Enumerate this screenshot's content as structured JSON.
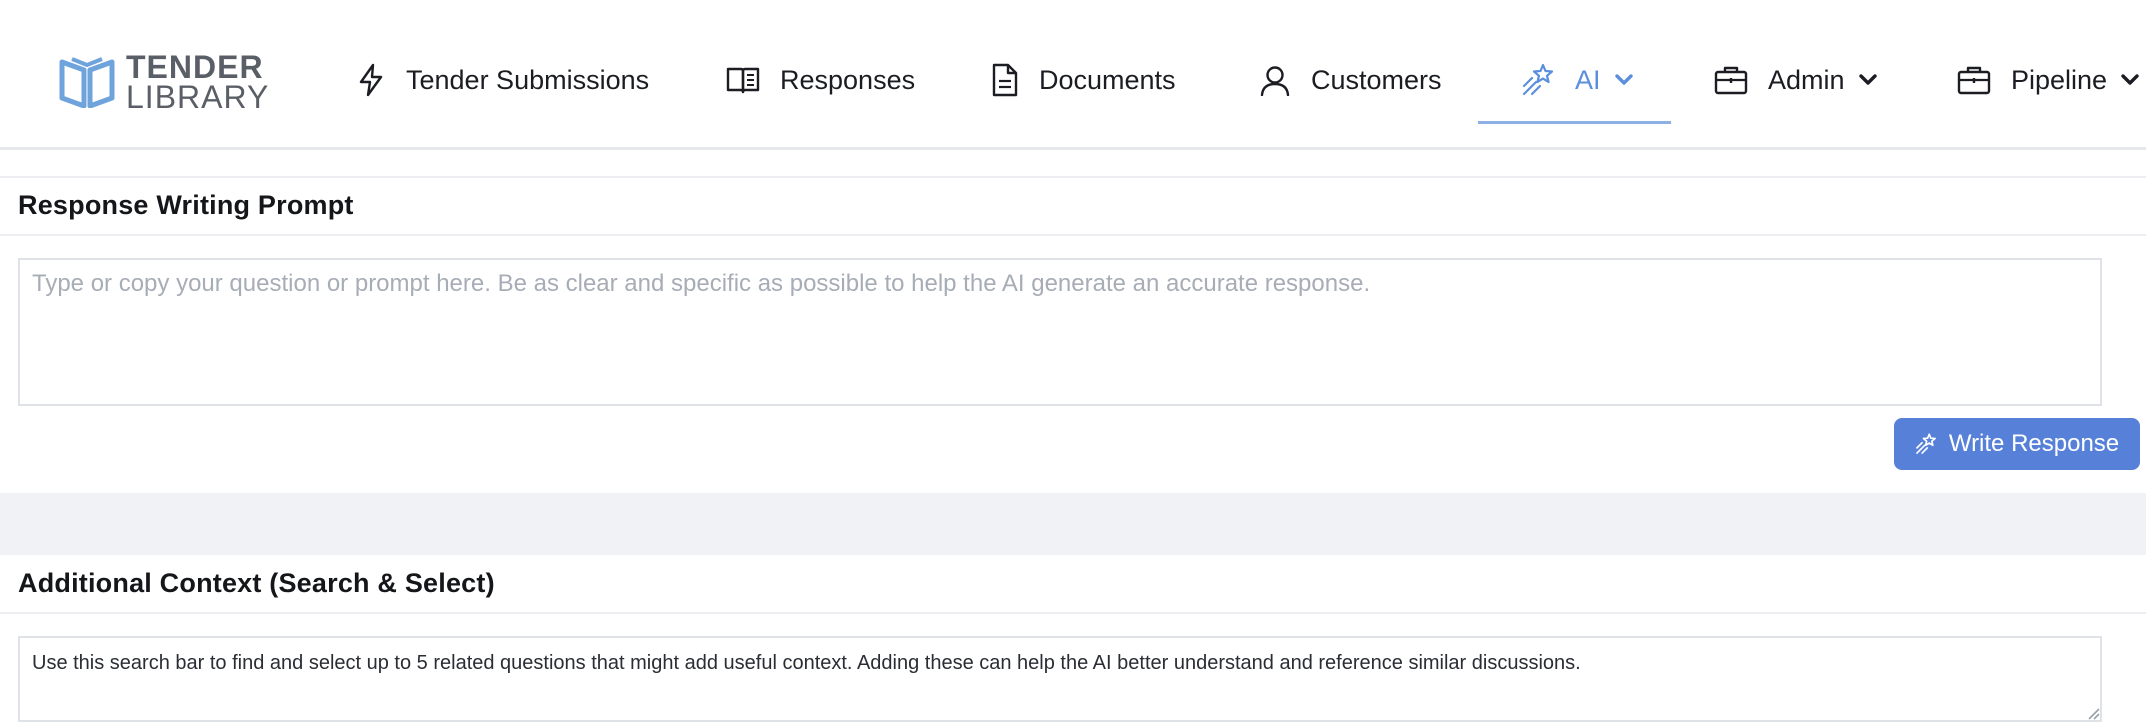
{
  "brand": {
    "line1": "TENDER",
    "line2": "LIBRARY",
    "logo_icon": "open-book-icon",
    "logo_color": "#6fa3db"
  },
  "nav": {
    "items": [
      {
        "label": "Tender Submissions",
        "icon": "lightning-icon",
        "active": false,
        "has_dropdown": false
      },
      {
        "label": "Responses",
        "icon": "book-icon",
        "active": false,
        "has_dropdown": false
      },
      {
        "label": "Documents",
        "icon": "document-icon",
        "active": false,
        "has_dropdown": false
      },
      {
        "label": "Customers",
        "icon": "user-icon",
        "active": false,
        "has_dropdown": false
      },
      {
        "label": "AI",
        "icon": "magic-wand-icon",
        "active": true,
        "has_dropdown": true
      },
      {
        "label": "Admin",
        "icon": "briefcase-icon",
        "active": false,
        "has_dropdown": true
      },
      {
        "label": "Pipeline",
        "icon": "briefcase-icon",
        "active": false,
        "has_dropdown": true
      }
    ],
    "active_color": "#5b8fde"
  },
  "prompt_section": {
    "title": "Response Writing Prompt",
    "placeholder": "Type or copy your question or prompt here. Be as clear and specific as possible to help the AI generate an accurate response.",
    "value": "",
    "button_label": "Write Response",
    "button_icon": "magic-wand-icon",
    "button_color": "#5781d8"
  },
  "context_section": {
    "title": "Additional Context (Search & Select)",
    "placeholder": "Use this search bar to find and select up to 5 related questions that might add useful context. Adding these can help the AI better understand and reference similar discussions."
  }
}
